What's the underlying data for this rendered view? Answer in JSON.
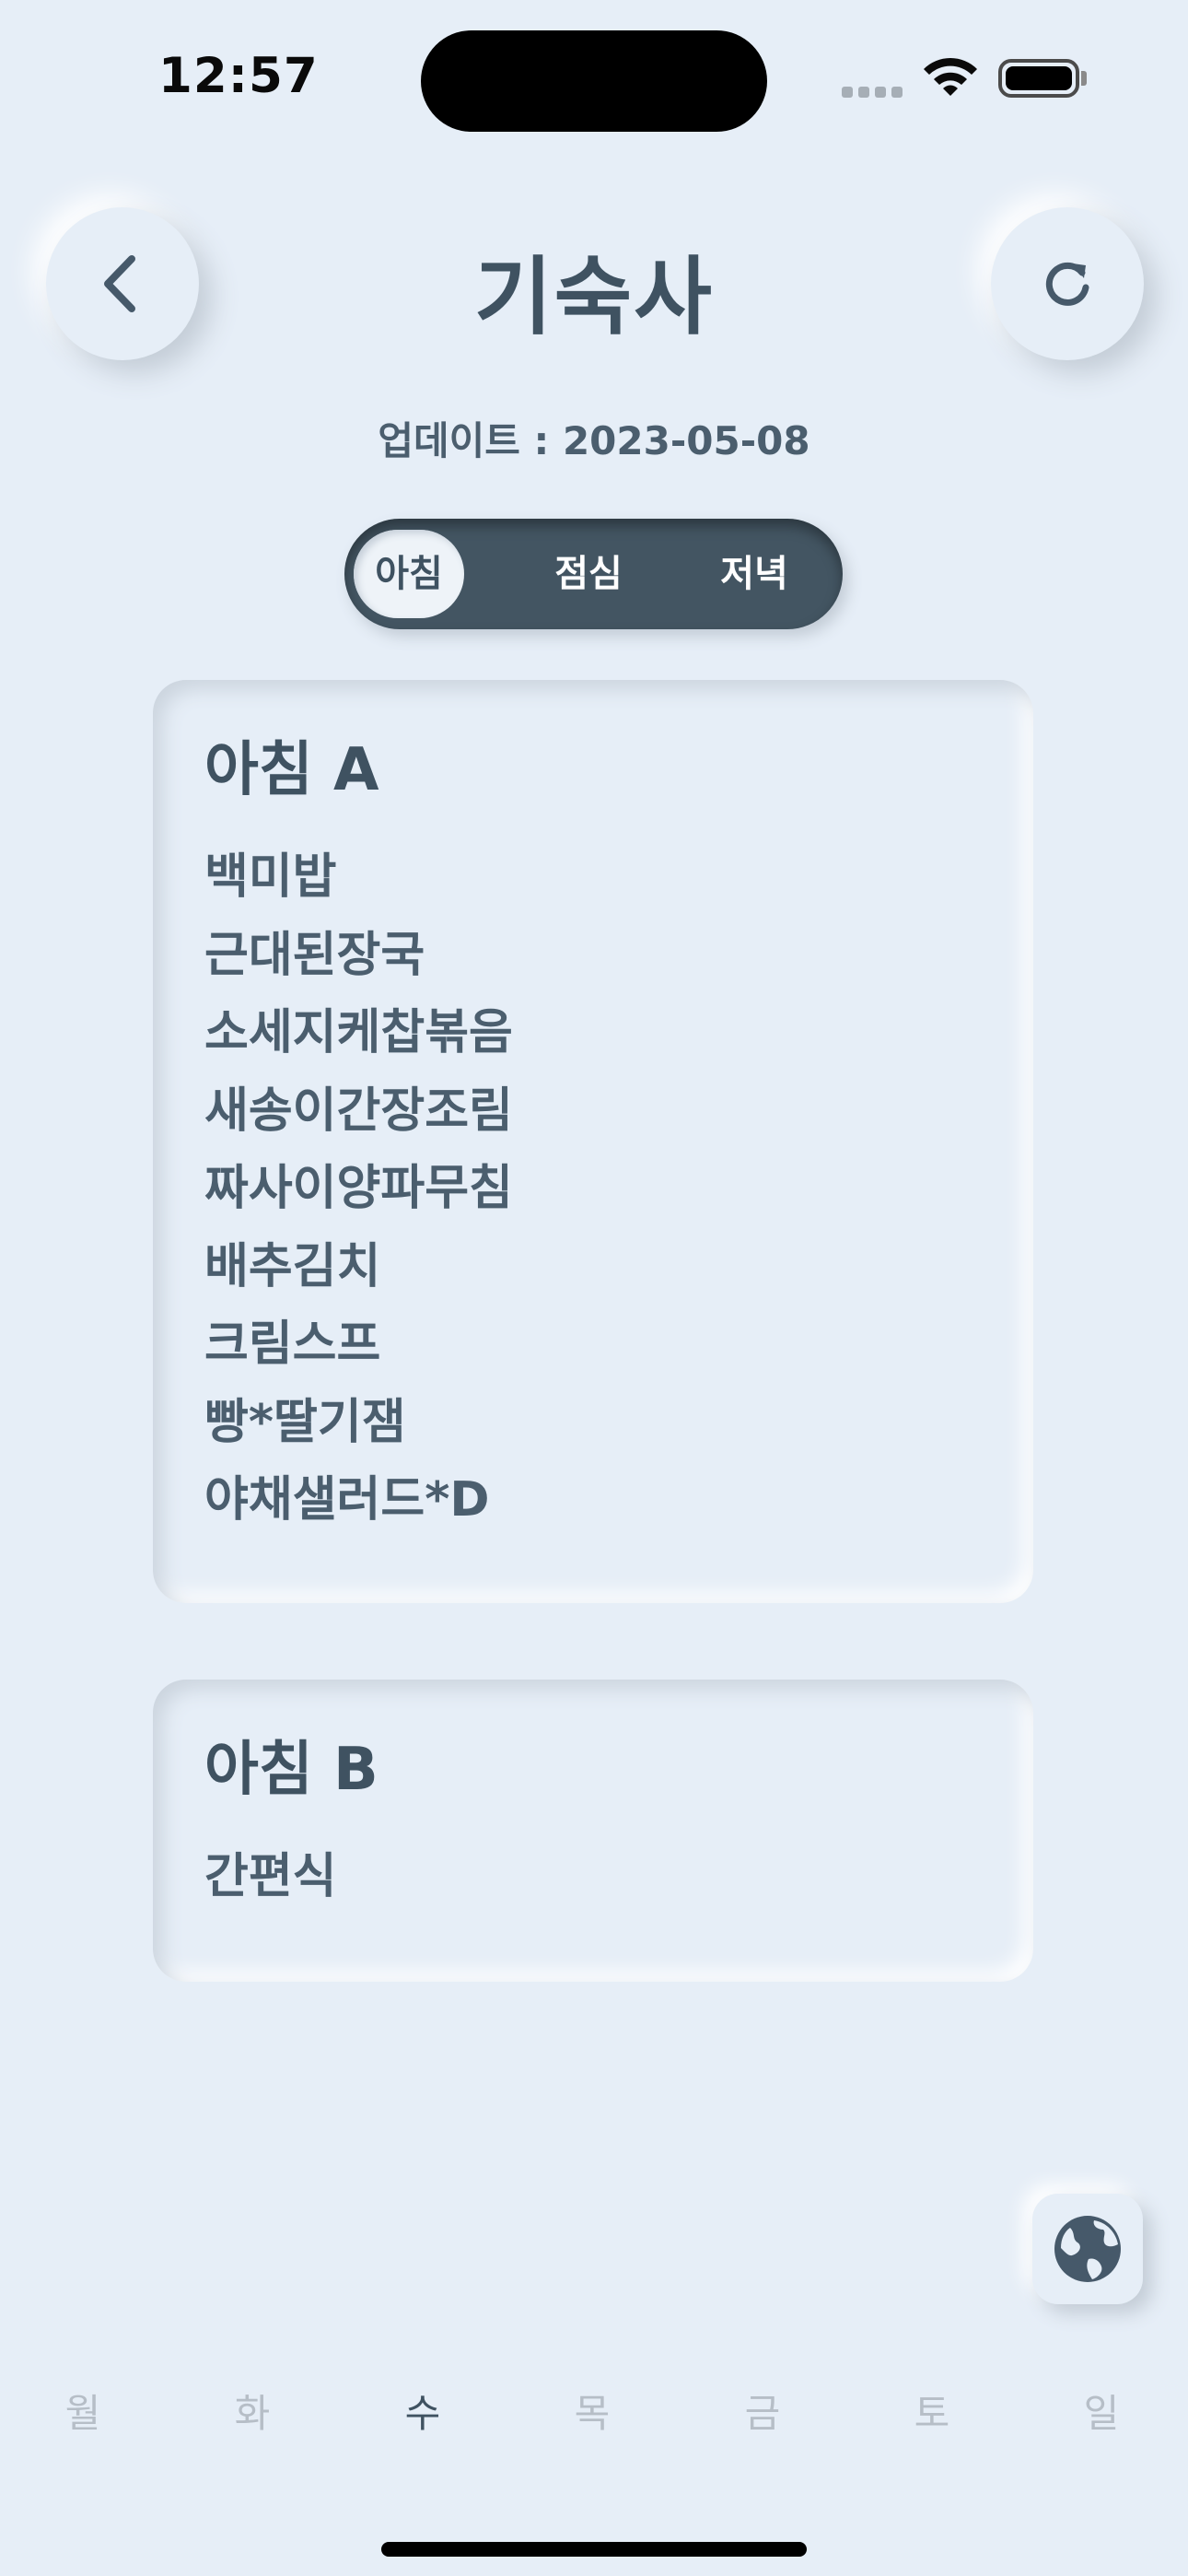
{
  "status_bar": {
    "time": "12:57"
  },
  "header": {
    "title": "기숙사",
    "back_icon": "chevron-left-icon",
    "refresh_icon": "refresh-icon"
  },
  "update": {
    "text": "업데이트 : 2023-05-08"
  },
  "meal_toggle": {
    "options": [
      "아침",
      "점심",
      "저녁"
    ],
    "selected": "아침"
  },
  "cards": [
    {
      "title": "아침 A",
      "items": [
        "백미밥",
        "근대된장국",
        "소세지케찹볶음",
        "새송이간장조림",
        "짜사이양파무침",
        "배추김치",
        "크림스프",
        "빵*딸기잼",
        "야채샐러드*D"
      ]
    },
    {
      "title": "아침 B",
      "items": [
        "간편식"
      ]
    }
  ],
  "floating_button": {
    "icon": "globe-icon"
  },
  "days": {
    "labels": [
      "월",
      "화",
      "수",
      "목",
      "금",
      "토",
      "일"
    ],
    "selected": "수"
  },
  "colors": {
    "background": "#e6eef7",
    "text": "#3f5261",
    "toggle_bg": "#435562",
    "inactive_day": "#b6bec7"
  }
}
